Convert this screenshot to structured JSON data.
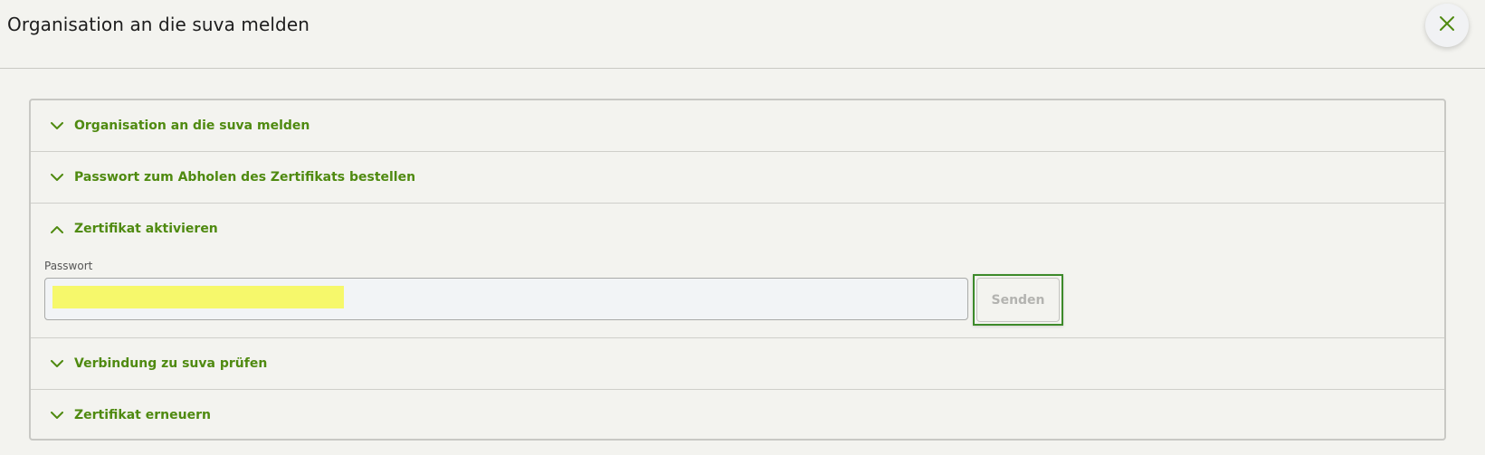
{
  "header": {
    "title": "Organisation an die suva melden",
    "close_icon": "close-icon"
  },
  "accordion": {
    "items": [
      {
        "label": "Organisation an die suva melden",
        "expanded": false,
        "icon": "chevron-down-icon"
      },
      {
        "label": "Passwort zum Abholen des Zertifikats bestellen",
        "expanded": false,
        "icon": "chevron-down-icon"
      },
      {
        "label": "Zertifikat aktivieren",
        "expanded": true,
        "icon": "chevron-up-icon"
      },
      {
        "label": "Verbindung zu suva prüfen",
        "expanded": false,
        "icon": "chevron-down-icon"
      },
      {
        "label": "Zertifikat erneuern",
        "expanded": false,
        "icon": "chevron-down-icon"
      }
    ]
  },
  "activate": {
    "password_label": "Passwort",
    "password_value": "",
    "send_label": "Senden",
    "send_disabled": true
  },
  "colors": {
    "accent": "#4f8a10",
    "focus_outline": "#3d8a2a",
    "redaction": "#f6f86b",
    "background": "#f3f3ef"
  }
}
